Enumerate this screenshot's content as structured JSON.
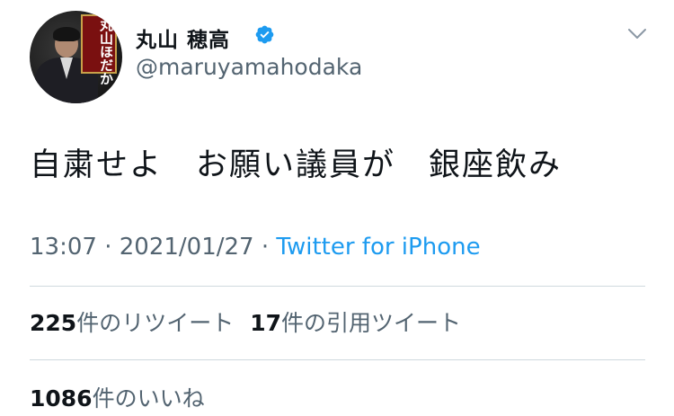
{
  "author": {
    "display_name": "丸山 穂高",
    "username": "@maruyamahodaka",
    "avatar_banner_text": "丸山ほだか",
    "verified": true,
    "verified_icon": "verified-badge-icon",
    "menu_icon": "chevron-down-icon"
  },
  "tweet": {
    "text": "自粛せよ　お願い議員が　銀座飲み",
    "time": "13:07",
    "date": "2021/01/27",
    "separator": "·",
    "source": "Twitter for iPhone"
  },
  "stats": {
    "retweets_count": "225",
    "retweets_label": "件のリツイート",
    "quotes_count": "17",
    "quotes_label": "件の引用ツイート",
    "likes_count": "1086",
    "likes_label": "件のいいね"
  },
  "colors": {
    "text_primary": "#0f1419",
    "text_secondary": "#536471",
    "link": "#1d9bf0",
    "verified": "#1d9bf0",
    "divider": "#cfd9de"
  }
}
